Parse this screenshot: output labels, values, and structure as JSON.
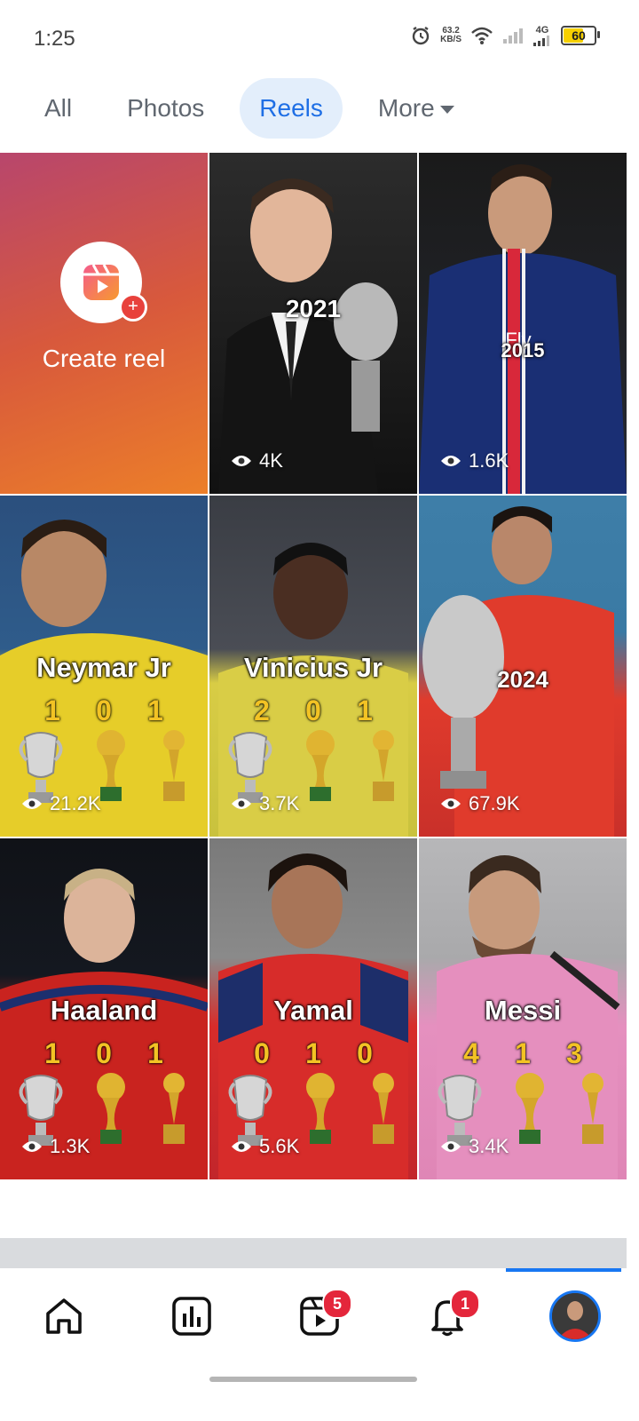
{
  "status_bar": {
    "time": "1:25",
    "net_speed_value": "63.2",
    "net_speed_unit": "KB/S",
    "network_type": "4G",
    "battery": "60"
  },
  "tabs": [
    {
      "label": "All",
      "active": false
    },
    {
      "label": "Photos",
      "active": false
    },
    {
      "label": "Reels",
      "active": true
    },
    {
      "label": "More",
      "active": false
    }
  ],
  "create_reel": {
    "label": "Create reel"
  },
  "reels": [
    {
      "overlay_year": "2021",
      "views": "4K"
    },
    {
      "overlay_year": "2015",
      "views": "1.6K"
    },
    {
      "name": "Neymar Jr",
      "counts": [
        "1",
        "0",
        "1"
      ],
      "views": "21.2K"
    },
    {
      "name": "Vinicius Jr",
      "counts": [
        "2",
        "0",
        "1"
      ],
      "views": "3.7K"
    },
    {
      "overlay_year": "2024",
      "views": "67.9K"
    },
    {
      "name": "Haaland",
      "counts": [
        "1",
        "0",
        "1"
      ],
      "views": "1.3K"
    },
    {
      "name": "Yamal",
      "counts": [
        "0",
        "1",
        "0"
      ],
      "views": "5.6K"
    },
    {
      "name": "Messi",
      "counts": [
        "4",
        "1",
        "3"
      ],
      "views": "3.4K"
    }
  ],
  "bottom_nav": {
    "reels_badge": "5",
    "notifications_badge": "1"
  },
  "colors": {
    "accent": "#1877f2",
    "active_tab_bg": "#e3eefb",
    "badge": "#e4263b"
  }
}
